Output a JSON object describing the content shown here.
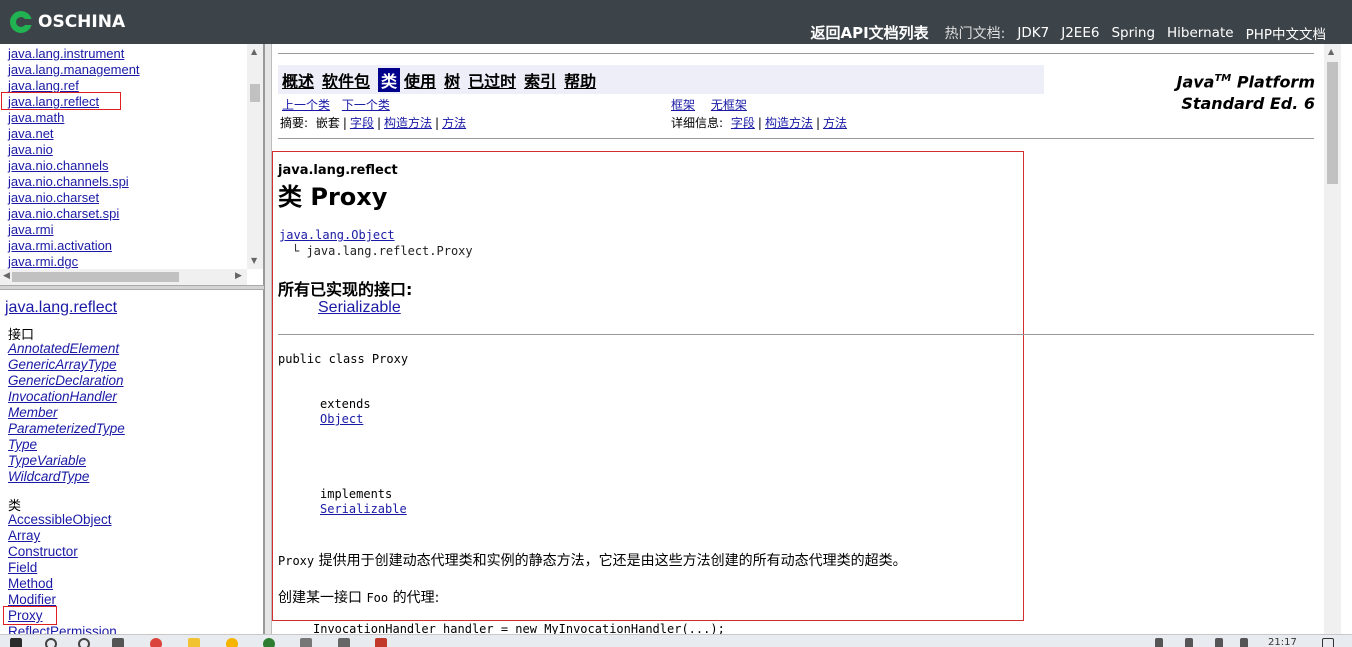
{
  "topbar": {
    "logo_text": "OSCHINA",
    "back_link": "返回API文档列表",
    "hot_label": "热门文档:",
    "hot_docs": [
      "JDK7",
      "J2EE6",
      "Spring",
      "Hibernate",
      "PHP中文文档"
    ]
  },
  "package_frame": {
    "packages": [
      "java.lang.instrument",
      "java.lang.management",
      "java.lang.ref",
      "java.lang.reflect",
      "java.math",
      "java.net",
      "java.nio",
      "java.nio.channels",
      "java.nio.channels.spi",
      "java.nio.charset",
      "java.nio.charset.spi",
      "java.rmi",
      "java.rmi.activation",
      "java.rmi.dgc"
    ],
    "highlighted": "java.lang.reflect"
  },
  "class_frame": {
    "package_title": "java.lang.reflect",
    "interfaces_heading": "接口",
    "interfaces": [
      "AnnotatedElement",
      "GenericArrayType",
      "GenericDeclaration",
      "InvocationHandler",
      "Member",
      "ParameterizedType",
      "Type",
      "TypeVariable",
      "WildcardType"
    ],
    "classes_heading": "类",
    "classes": [
      "AccessibleObject",
      "Array",
      "Constructor",
      "Field",
      "Method",
      "Modifier",
      "Proxy",
      "ReflectPermission"
    ],
    "highlighted": "Proxy"
  },
  "main": {
    "navbar": [
      {
        "label": "概述",
        "active": false
      },
      {
        "label": "软件包",
        "active": false
      },
      {
        "label": "类",
        "active": true
      },
      {
        "label": "使用",
        "active": false
      },
      {
        "label": "树",
        "active": false
      },
      {
        "label": "已过时",
        "active": false
      },
      {
        "label": "索引",
        "active": false
      },
      {
        "label": "帮助",
        "active": false
      }
    ],
    "brand_line1": "Java",
    "brand_tm": "TM",
    "brand_line1_rest": " Platform",
    "brand_line2": "Standard Ed. 6",
    "prev_class": "上一个类",
    "next_class": "下一个类",
    "frames": "框架",
    "no_frames": "无框架",
    "summary_label": "摘要:",
    "summary_nested": "嵌套",
    "summary_field": "字段",
    "summary_constructor": "构造方法",
    "summary_method": "方法",
    "detail_label": "详细信息:",
    "detail_field": "字段",
    "detail_constructor": "构造方法",
    "detail_method": "方法",
    "package_name": "java.lang.reflect",
    "class_title": "类 Proxy",
    "inherit_parent": "java.lang.Object",
    "inherit_child": "└ java.lang.reflect.Proxy",
    "implemented_heading": "所有已实现的接口:",
    "implemented_iface": "Serializable",
    "declaration": "public class Proxy",
    "extends_kw": "extends",
    "extends_class": "Object",
    "implements_kw": "implements",
    "implements_iface": "Serializable",
    "desc_code": "Proxy",
    "desc_text": " 提供用于创建动态代理类和实例的静态方法，它还是由这些方法创建的所有动态代理类的超类。",
    "desc2_pre": "创建某一接口 ",
    "desc2_code": "Foo",
    "desc2_post": " 的代理:",
    "code_line": "InvocationHandler handler = new MyInvocationHandler(...);"
  },
  "taskbar": {
    "time": "21:17"
  }
}
